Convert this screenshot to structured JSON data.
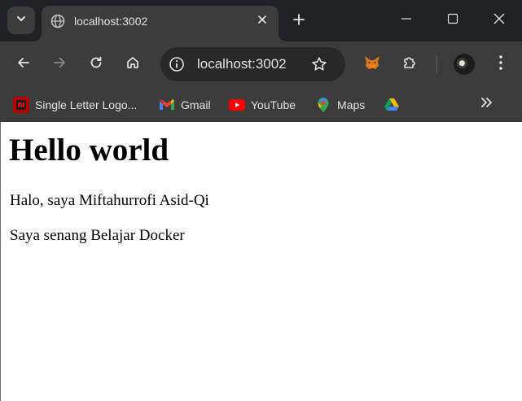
{
  "browser": {
    "tab": {
      "title": "localhost:3002",
      "favicon": "globe-icon"
    },
    "address_bar": {
      "url": "localhost:3002"
    },
    "bookmarks": [
      {
        "label": "Single Letter Logo...",
        "icon": "single-letter-logo-icon"
      },
      {
        "label": "Gmail",
        "icon": "gmail-icon"
      },
      {
        "label": "YouTube",
        "icon": "youtube-icon"
      },
      {
        "label": "Maps",
        "icon": "maps-icon"
      },
      {
        "label": "",
        "icon": "google-drive-icon"
      }
    ],
    "colors": {
      "tabstrip": "#202124",
      "toolbar": "#3c3c3c",
      "omnibox": "#282828",
      "text": "#e3e3e3"
    }
  },
  "page": {
    "heading": "Hello world",
    "paragraphs": [
      "Halo, saya Miftahurrofi Asid-Qi",
      "Saya senang Belajar Docker"
    ]
  }
}
